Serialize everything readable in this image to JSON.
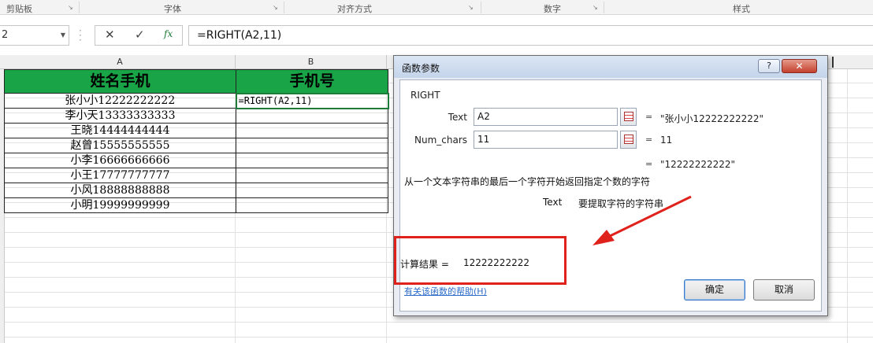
{
  "ribbon": {
    "groups": [
      "剪贴板",
      "字体",
      "对齐方式",
      "数字",
      "样式"
    ]
  },
  "formula_bar": {
    "name_box": "2",
    "cancel_icon": "✕",
    "enter_icon": "✓",
    "fx_icon": "fx",
    "formula": "=RIGHT(A2,11)"
  },
  "sheet": {
    "columns": [
      "A",
      "B"
    ],
    "headers": [
      "姓名手机",
      "手机号"
    ],
    "rows": [
      [
        "张小小12222222222",
        "=RIGHT(A2,11)"
      ],
      [
        "李小天13333333333",
        ""
      ],
      [
        "王晓14444444444",
        ""
      ],
      [
        "赵曾15555555555",
        ""
      ],
      [
        "小李16666666666",
        ""
      ],
      [
        "小王17777777777",
        ""
      ],
      [
        "小风18888888888",
        ""
      ],
      [
        "小明19999999999",
        ""
      ]
    ],
    "header_color": "#19a547"
  },
  "dialog": {
    "title": "函数参数",
    "help_icon": "?",
    "close_icon": "✕",
    "function_name": "RIGHT",
    "args": [
      {
        "label": "Text",
        "value": "A2",
        "eq": "=",
        "result": "\"张小小12222222222\""
      },
      {
        "label": "Num_chars",
        "value": "11",
        "eq": "=",
        "result": "11"
      }
    ],
    "overall_eq": "=",
    "overall_result": "\"12222222222\"",
    "description": "从一个文本字符串的最后一个字符开始返回指定个数的字符",
    "arg_desc_name": "Text",
    "arg_desc_text": "要提取字符的字符串",
    "result_label": "计算结果 =",
    "result_value": "12222222222",
    "help_link": "有关该函数的帮助(H)",
    "ok_label": "确定",
    "cancel_label": "取消"
  },
  "annotation": {
    "color": "#e0221c"
  }
}
